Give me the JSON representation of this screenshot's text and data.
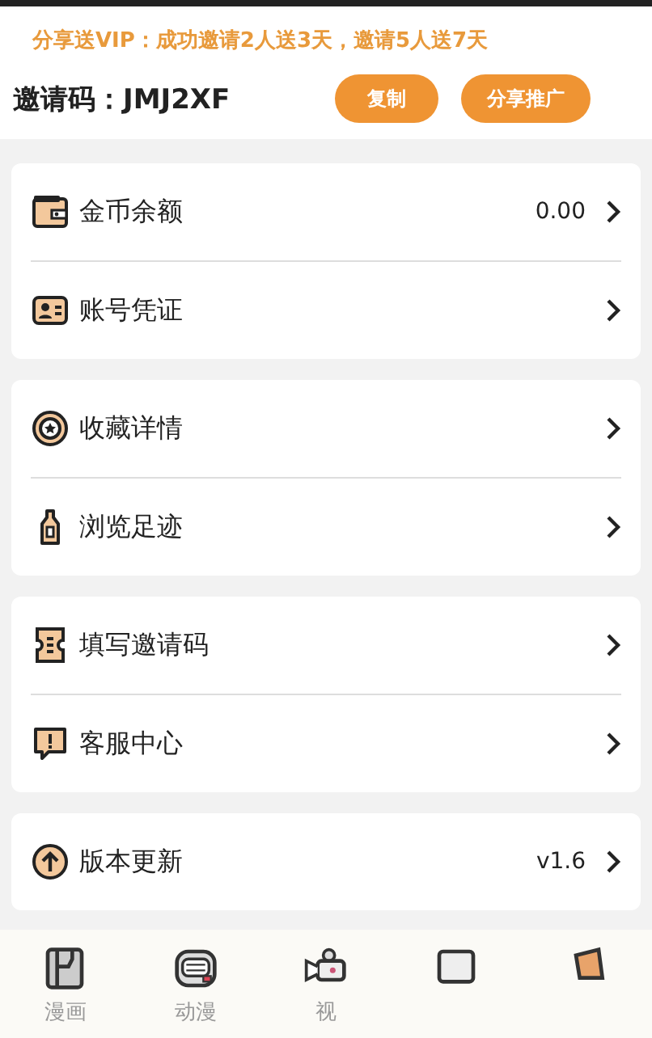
{
  "promo": "分享送VIP：成功邀请2人送3天，邀请5人送7天",
  "invite": {
    "label": "邀请码：",
    "code": "JMJ2XF",
    "buttons": [
      "复制",
      "分享推广"
    ]
  },
  "groups": [
    {
      "items": [
        {
          "label": "金币余额",
          "value": "0.00"
        },
        {
          "label": "账号凭证"
        }
      ]
    },
    {
      "items": [
        {
          "label": "收藏详情"
        },
        {
          "label": "浏览足迹"
        }
      ]
    },
    {
      "items": [
        {
          "label": "填写邀请码"
        },
        {
          "label": "客服中心"
        }
      ]
    },
    {
      "items": [
        {
          "label": "版本更新",
          "value": "v1.6"
        }
      ]
    }
  ],
  "tab_bar": [
    {
      "kind": "labeled",
      "label": "漫画"
    },
    {
      "kind": "labeled",
      "label": "动漫"
    },
    {
      "kind": "labeled",
      "label": "视"
    },
    {
      "kind": "icon"
    },
    {
      "kind": "icon"
    }
  ]
}
